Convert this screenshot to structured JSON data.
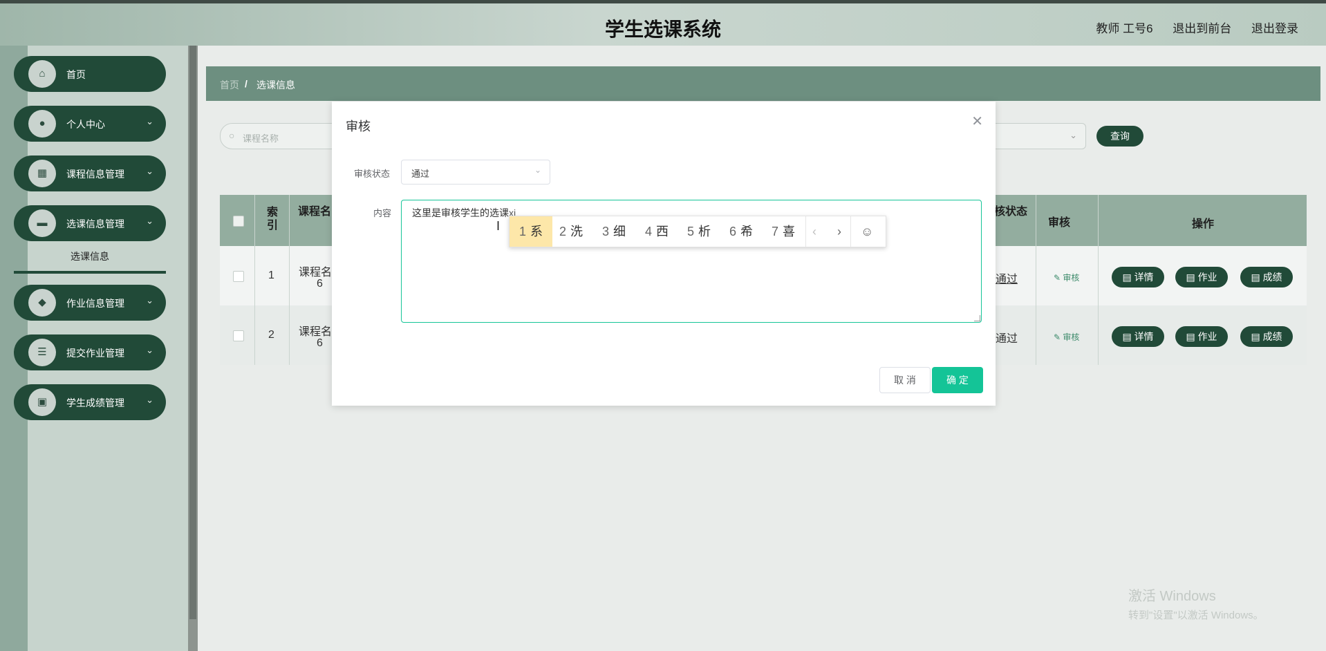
{
  "header": {
    "title": "学生选课系统",
    "user": "教师 工号6",
    "to_front": "退出到前台",
    "logout": "退出登录"
  },
  "sidebar": {
    "items": [
      {
        "label": "首页",
        "icon": "home-icon"
      },
      {
        "label": "个人中心",
        "icon": "user-icon"
      },
      {
        "label": "课程信息管理",
        "icon": "grid-icon"
      },
      {
        "label": "选课信息管理",
        "icon": "monitor-icon"
      },
      {
        "label": "作业信息管理",
        "icon": "location-icon"
      },
      {
        "label": "提交作业管理",
        "icon": "list-icon"
      },
      {
        "label": "学生成绩管理",
        "icon": "briefcase-icon"
      }
    ],
    "submenu_active": "选课信息"
  },
  "breadcrumb": {
    "home": "首页",
    "sep": "/",
    "current": "选课信息"
  },
  "search": {
    "placeholder": "课程名称",
    "query_button": "查询"
  },
  "table": {
    "headers": {
      "index": "索\n引",
      "course": "课程名",
      "status": "核状态",
      "audit": "审核",
      "ops": "操作"
    },
    "rows": [
      {
        "index": "1",
        "course": "课程名",
        "course_sub": "6",
        "status": "通过",
        "audit": "审核"
      },
      {
        "index": "2",
        "course": "课程名",
        "course_sub": "6",
        "status": "通过",
        "audit": "审核"
      }
    ],
    "op_buttons": [
      "详情",
      "作业",
      "成绩"
    ]
  },
  "dialog": {
    "title": "审核",
    "status_label": "审核状态",
    "status_value": "通过",
    "content_label": "内容",
    "content_text": "这里是审核学生的选课",
    "content_pinyin": "xi",
    "cancel": "取 消",
    "confirm": "确 定"
  },
  "ime": {
    "candidates": [
      {
        "n": "1",
        "c": "系"
      },
      {
        "n": "2",
        "c": "洗"
      },
      {
        "n": "3",
        "c": "细"
      },
      {
        "n": "4",
        "c": "西"
      },
      {
        "n": "5",
        "c": "析"
      },
      {
        "n": "6",
        "c": "希"
      },
      {
        "n": "7",
        "c": "喜"
      }
    ],
    "prev": "‹",
    "next": "›",
    "emoji": "☺"
  },
  "watermark": {
    "line1": "激活 Windows",
    "line2": "转到\"设置\"以激活 Windows。"
  },
  "colors": {
    "primary": "#214a38",
    "accent": "#14c497",
    "header_band": "#6d8f80"
  }
}
